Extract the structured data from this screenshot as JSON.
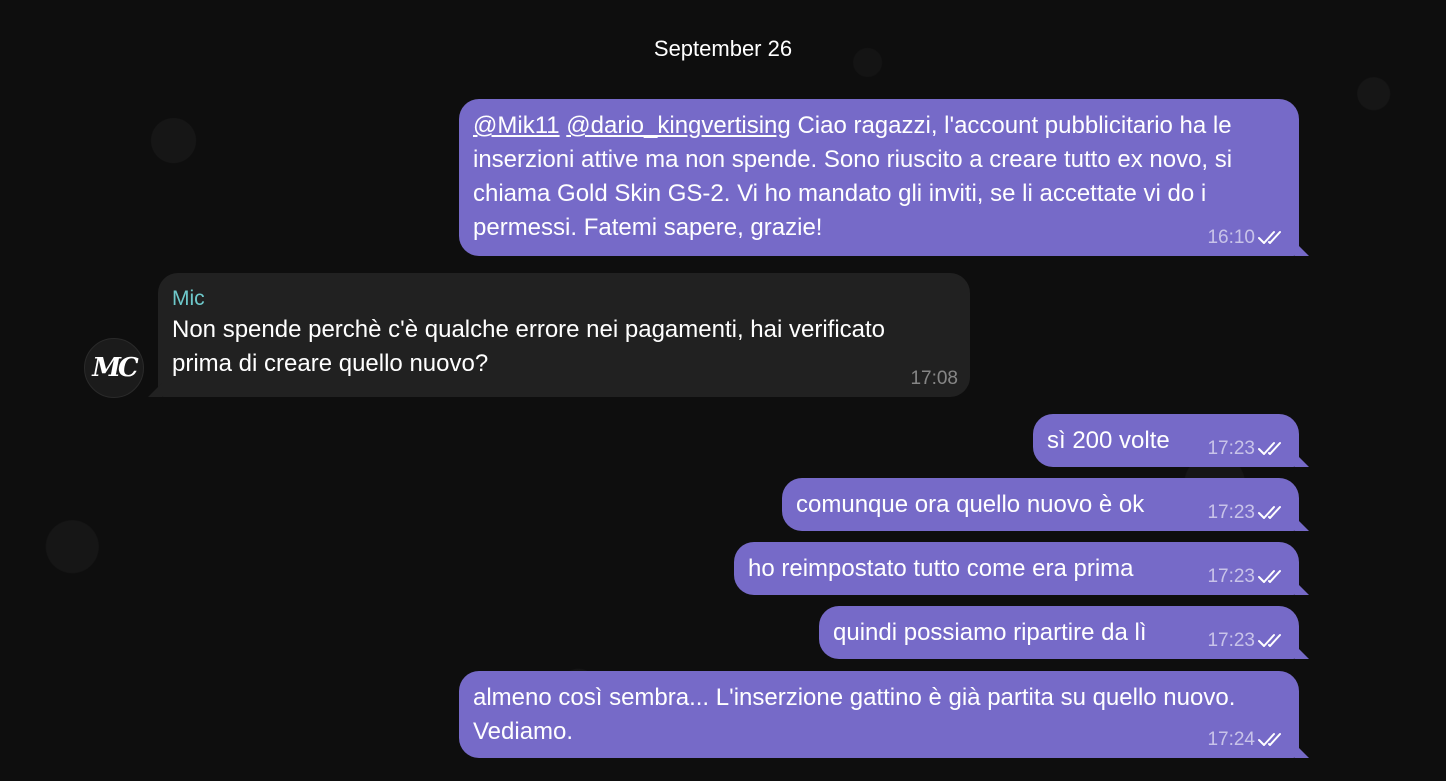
{
  "date_label": "September 26",
  "messages": [
    {
      "direction": "out",
      "mentions": [
        "@Mik11",
        "@dario_kingvertising"
      ],
      "text": "Ciao ragazzi, l'account pubblicitario ha le inserzioni attive ma non spende. Sono riuscito a creare tutto ex novo, si chiama Gold Skin GS-2. Vi ho mandato gli inviti, se li accettate vi do i permessi. Fatemi sapere, grazie!",
      "time": "16:10",
      "status": "read"
    },
    {
      "direction": "in",
      "sender": "Mic",
      "text": "Non spende perchè c'è qualche errore nei pagamenti, hai verificato prima di creare quello nuovo?",
      "time": "17:08"
    },
    {
      "direction": "out",
      "text": "sì 200 volte",
      "time": "17:23",
      "status": "read"
    },
    {
      "direction": "out",
      "text": "comunque ora quello nuovo è ok",
      "time": "17:23",
      "status": "read"
    },
    {
      "direction": "out",
      "text": "ho reimpostato tutto come era prima",
      "time": "17:23",
      "status": "read"
    },
    {
      "direction": "out",
      "text": "quindi possiamo ripartire da lì",
      "time": "17:23",
      "status": "read"
    },
    {
      "direction": "out",
      "text": "almeno così sembra... L'inserzione gattino è già partita su quello nuovo. Vediamo.",
      "time": "17:24",
      "status": "read"
    }
  ],
  "avatar": {
    "initials": "MC",
    "icon": "mc-logo-avatar"
  },
  "colors": {
    "background": "#0e0e0e",
    "outgoing_bubble": "#766ac8",
    "incoming_bubble": "#212121",
    "sender_name": "#6ec9cb"
  }
}
